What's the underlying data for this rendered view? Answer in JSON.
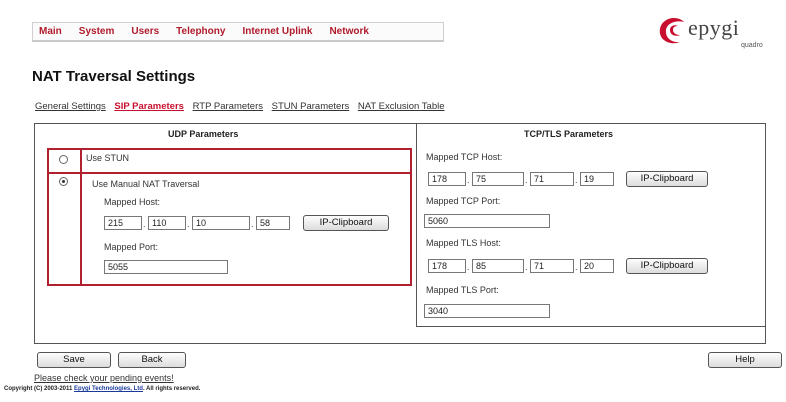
{
  "nav": [
    "Main",
    "System",
    "Users",
    "Telephony",
    "Internet Uplink",
    "Network"
  ],
  "logo": {
    "name": "epygi",
    "sub": "quadro"
  },
  "page_title": "NAT Traversal Settings",
  "subtabs": [
    "General Settings",
    "SIP Parameters",
    "RTP Parameters",
    "STUN Parameters",
    "NAT Exclusion Table"
  ],
  "active_subtab": "SIP Parameters",
  "udp": {
    "title": "UDP Parameters",
    "use_stun": "Use STUN",
    "manual": "Use Manual NAT Traversal",
    "mapped_host_label": "Mapped Host:",
    "host": [
      "215",
      "110",
      "10",
      "58"
    ],
    "clipboard": "IP-Clipboard",
    "mapped_port_label": "Mapped Port:",
    "port": "5055"
  },
  "tcp": {
    "title": "TCP/TLS Parameters",
    "tcp_host_label": "Mapped TCP Host:",
    "tcp_host": [
      "178",
      "75",
      "71",
      "19"
    ],
    "tcp_port_label": "Mapped TCP Port:",
    "tcp_port": "5060",
    "tls_host_label": "Mapped TLS Host:",
    "tls_host": [
      "178",
      "85",
      "71",
      "20"
    ],
    "tls_port_label": "Mapped TLS Port:",
    "tls_port": "3040",
    "clipboard": "IP-Clipboard"
  },
  "buttons": {
    "save": "Save",
    "back": "Back",
    "help": "Help"
  },
  "pending_link": "Please check your pending events!",
  "copyright_prefix": "Copyright (C) 2003-2011 ",
  "copyright_link": "Epygi Technologies, Ltd",
  "copyright_suffix": ". All rights reserved.",
  "colors": {
    "accent": "#b0202e",
    "tab_active": "#c8102e",
    "logo_red": "#c8102e"
  }
}
